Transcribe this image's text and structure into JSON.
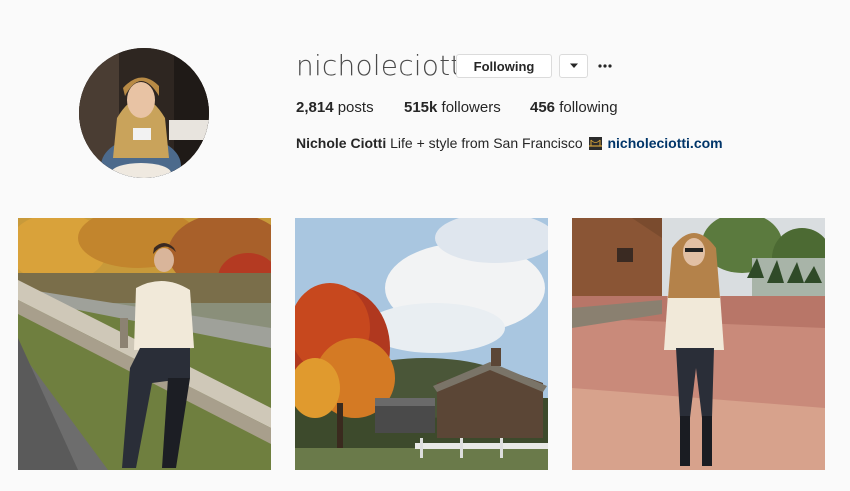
{
  "profile": {
    "username": "nicholeciotti",
    "follow_button_label": "Following",
    "dropdown_icon": "chevron-down-icon",
    "more_icon": "more-options-icon",
    "stats": {
      "posts_count": "2,814",
      "posts_label": " posts",
      "followers_count": "515k",
      "followers_label": " followers",
      "following_count": "456",
      "following_label": " following"
    },
    "bio": {
      "full_name": "Nichole Ciotti",
      "text": " Life + style from San Francisco ",
      "link": "nicholeciotti.com"
    }
  },
  "posts": [
    {
      "subject": "woman in cream sweater sitting on wooden guardrail by autumn road"
    },
    {
      "subject": "red autumn tree beside wooden barn under cloudy sky"
    },
    {
      "subject": "woman standing in field of fallen leaves near log cabin"
    }
  ],
  "colors": {
    "background": "#fafafa",
    "text": "#262626",
    "link": "#003569",
    "border": "#dbdbdb"
  }
}
